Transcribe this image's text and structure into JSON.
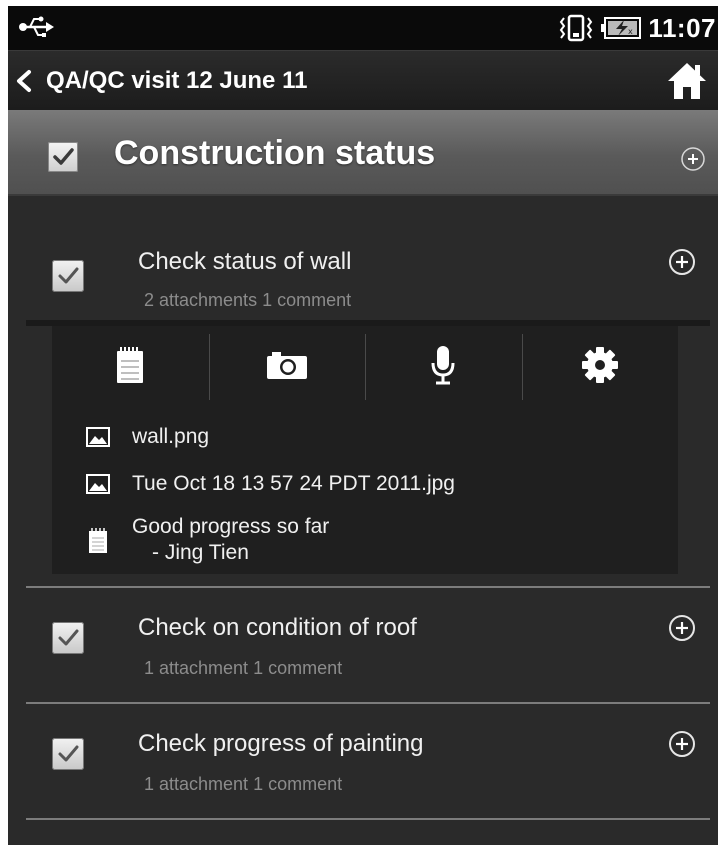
{
  "status_bar": {
    "time": "11:07",
    "icons": [
      "usb-icon",
      "vibrate-icon",
      "battery-charging-icon"
    ]
  },
  "action_bar": {
    "title": "QA/QC visit 12 June 11",
    "icons": [
      "back-chevron-icon",
      "home-icon"
    ]
  },
  "section": {
    "title": "Construction status",
    "checked": true,
    "icons": [
      "add-circle-icon"
    ]
  },
  "items": [
    {
      "title": "Check status of wall",
      "meta": "2 attachments 1 comment",
      "checked": true,
      "expanded": true
    },
    {
      "title": "Check on condition of roof",
      "meta": "1 attachment 1 comment",
      "checked": true,
      "expanded": false
    },
    {
      "title": "Check progress of painting",
      "meta": "1 attachment 1 comment",
      "checked": true,
      "expanded": false
    }
  ],
  "toolbar": {
    "icons": [
      "notepad-icon",
      "camera-icon",
      "microphone-icon",
      "gear-icon"
    ]
  },
  "attachments": [
    {
      "type": "image",
      "name": "wall.png"
    },
    {
      "type": "image",
      "name": "Tue Oct 18 13 57 24 PDT 2011.jpg"
    }
  ],
  "comment": {
    "text": "Good progress so far",
    "author": "- Jing Tien"
  },
  "colors": {
    "background": "#2a2a2a",
    "section_header": "#6a6a6a",
    "meta_text": "#8c8c8c",
    "panel": "#1f1f1f"
  }
}
